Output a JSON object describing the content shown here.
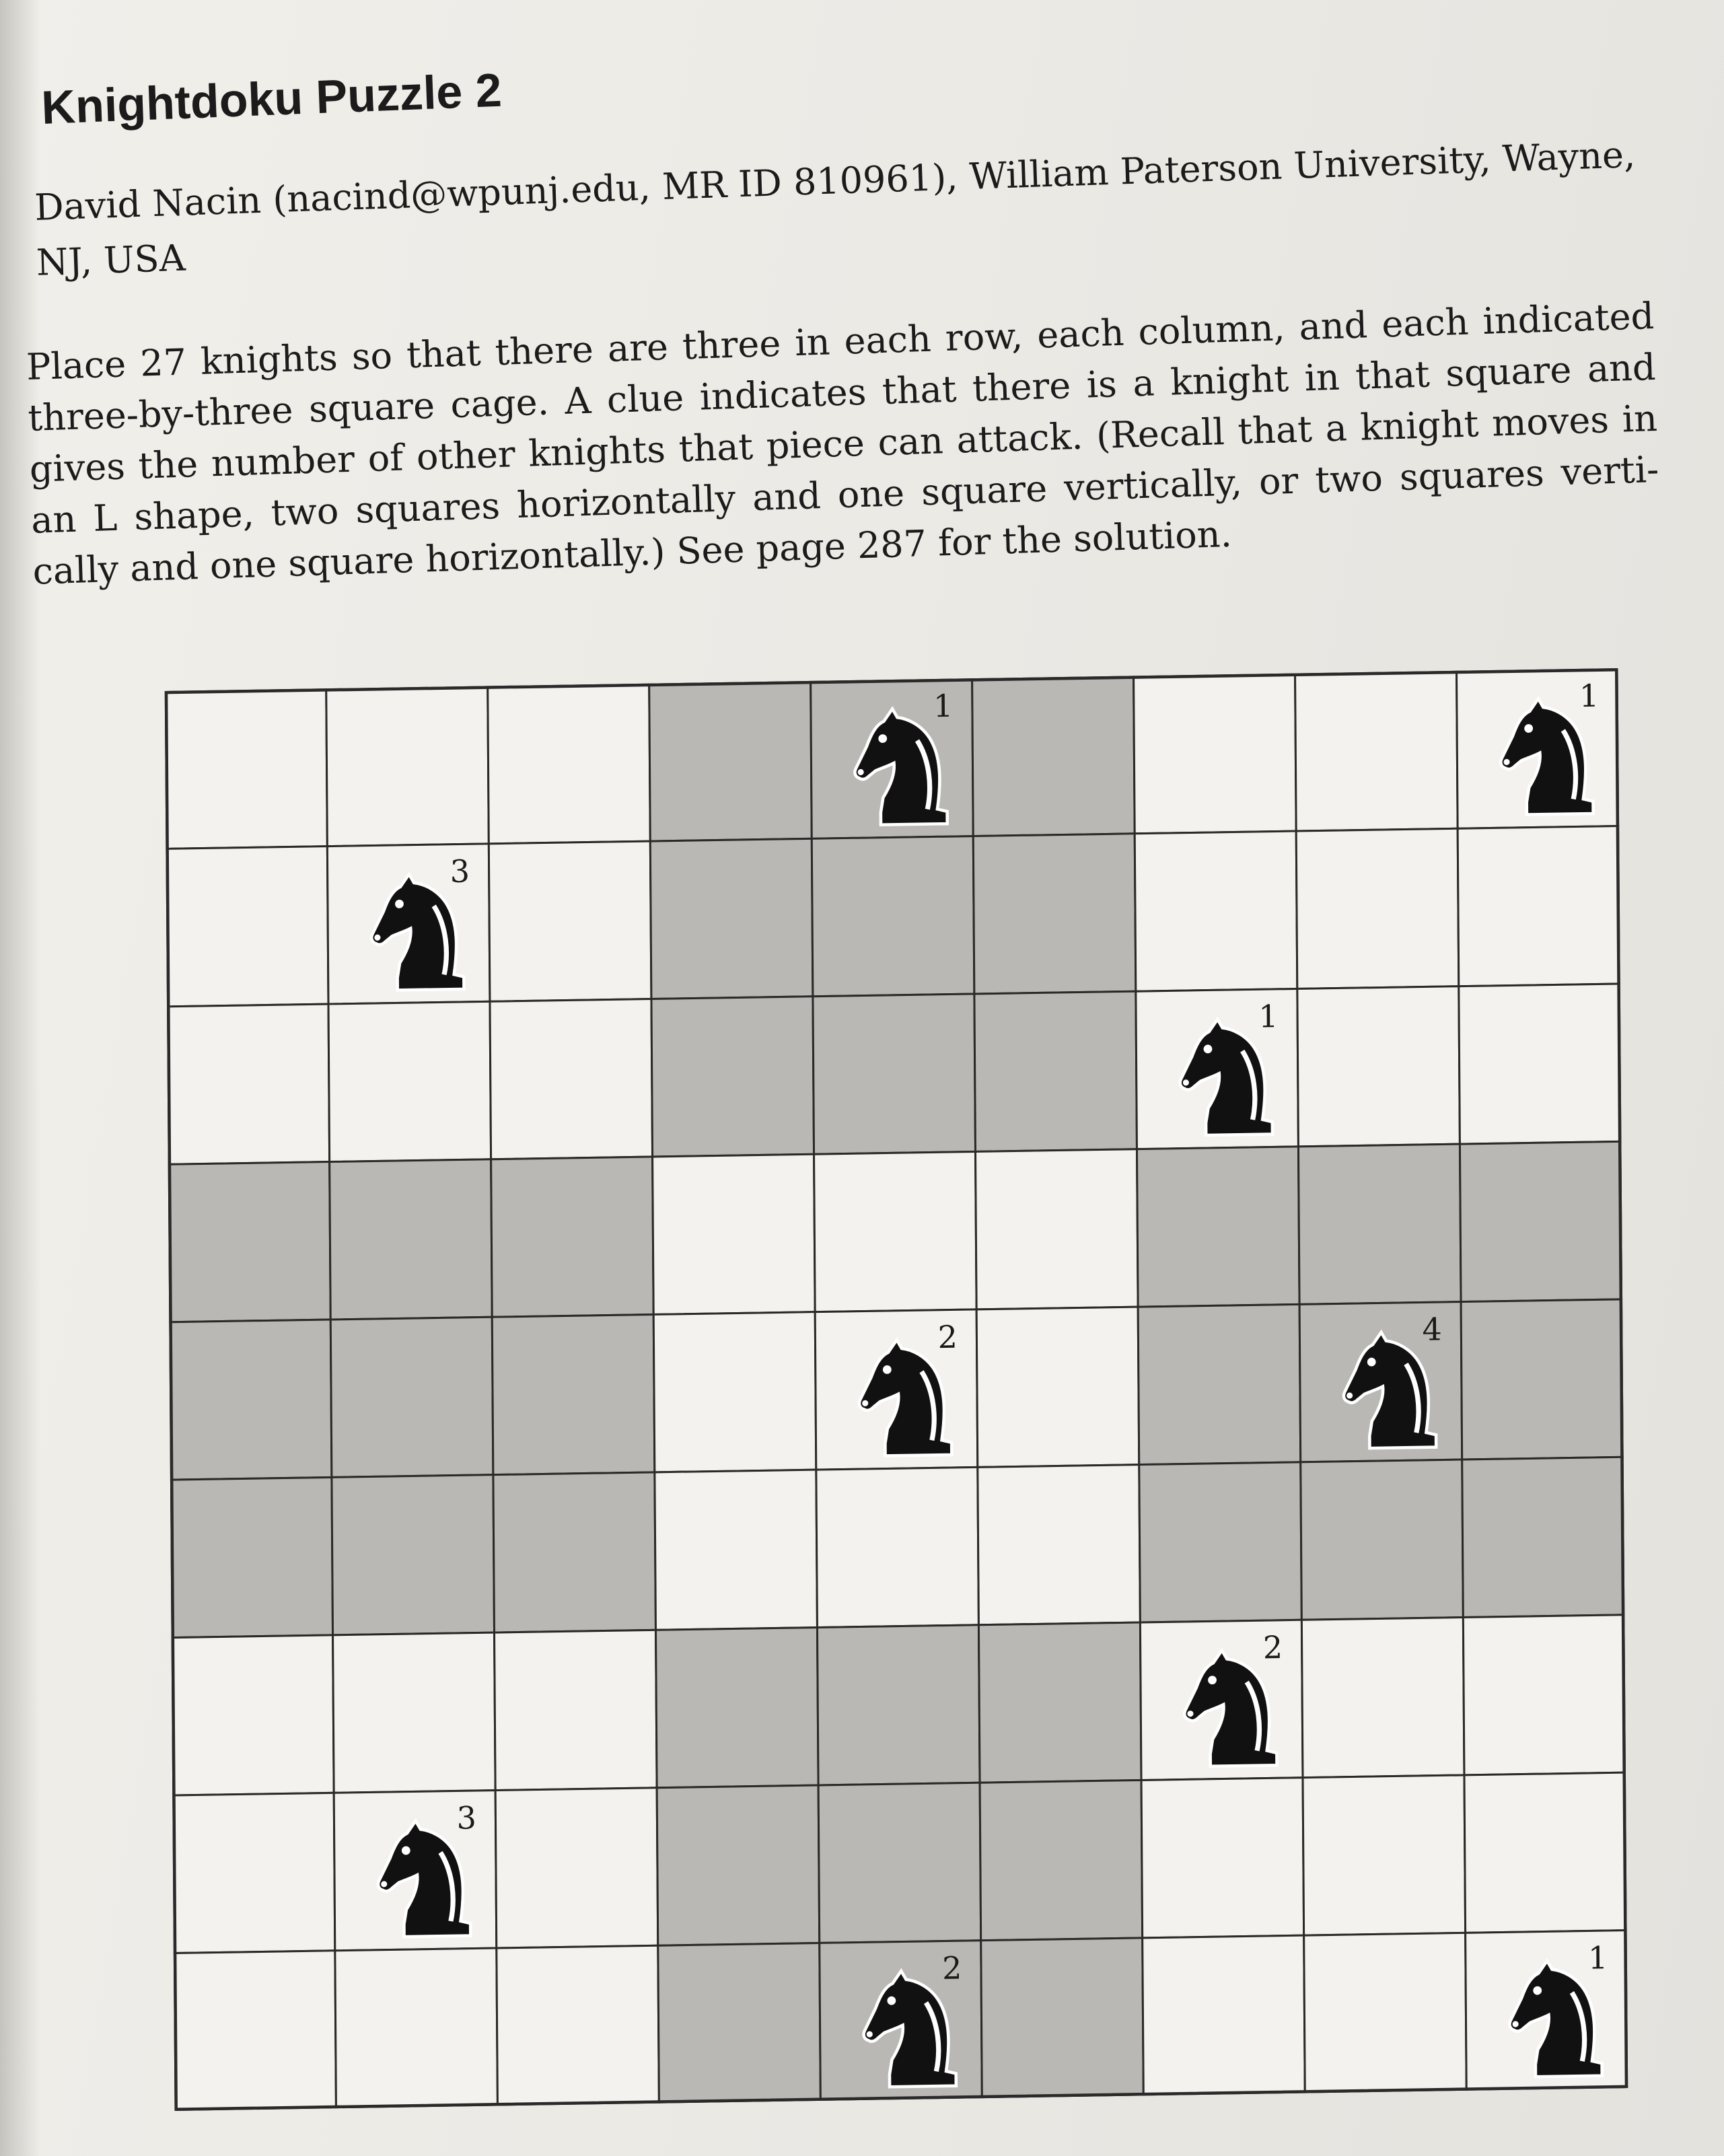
{
  "puzzle": {
    "title": "Knightdoku Puzzle 2",
    "author_line": "David Nacin (nacind@wpunj.edu, MR ID 810961), William Paterson University, Wayne, NJ, USA",
    "instructions": "Place 27 knights so that there are three in each row, each column, and each indicated three-by-three square cage. A clue indicates that there is a knight in that square and gives the number of other knights that piece can attack. (Recall that a knight moves in an L shape, two squares horizontally and one square vertically, or two squares verti-cally and one square horizontally.) See page 287 for the solution."
  },
  "board": {
    "rows": 9,
    "cols": 9,
    "shaded_cages": [
      [
        0,
        1
      ],
      [
        1,
        0
      ],
      [
        1,
        2
      ],
      [
        2,
        1
      ]
    ],
    "colors": {
      "light": "#f3f2ee",
      "shaded": "#b9b8b4",
      "line": "#2a2a2a",
      "knight": "#111111"
    },
    "clues": [
      {
        "row": 0,
        "col": 4,
        "value": "1"
      },
      {
        "row": 0,
        "col": 8,
        "value": "1"
      },
      {
        "row": 1,
        "col": 1,
        "value": "3"
      },
      {
        "row": 2,
        "col": 6,
        "value": "1"
      },
      {
        "row": 4,
        "col": 4,
        "value": "2"
      },
      {
        "row": 4,
        "col": 7,
        "value": "4"
      },
      {
        "row": 6,
        "col": 6,
        "value": "2"
      },
      {
        "row": 7,
        "col": 1,
        "value": "3"
      },
      {
        "row": 8,
        "col": 4,
        "value": "2"
      },
      {
        "row": 8,
        "col": 8,
        "value": "1"
      }
    ],
    "clue_icon": "chess-knight-icon"
  }
}
